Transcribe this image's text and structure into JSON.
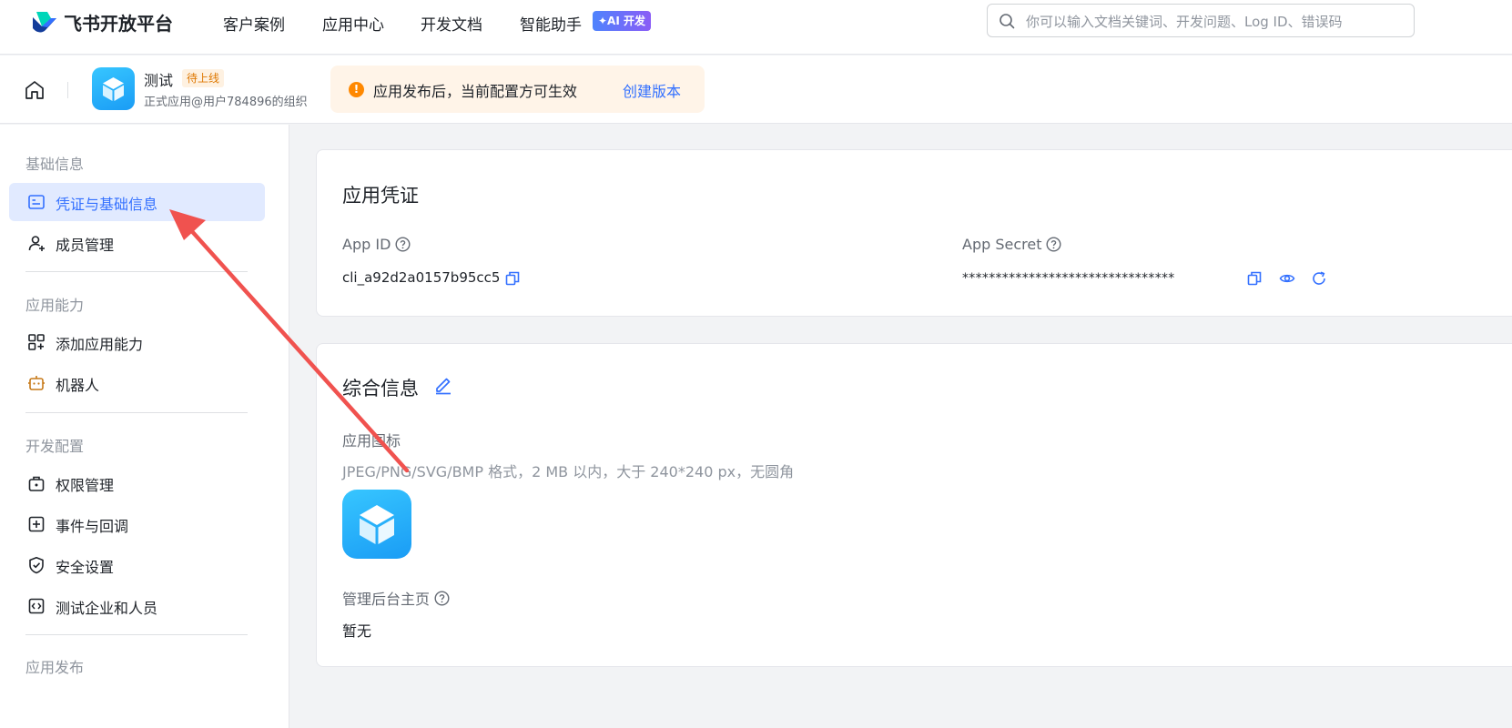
{
  "topnav": {
    "brand": "飞书开放平台",
    "links": [
      "客户案例",
      "应用中心",
      "开发文档",
      "智能助手"
    ],
    "ai_badge": "✦AI 开发",
    "search_placeholder": "你可以输入文档关键词、开发问题、Log ID、错误码"
  },
  "appbar": {
    "app_name": "测试",
    "status": "待上线",
    "org": "正式应用@用户784896的组织",
    "notice_text": "应用发布后，当前配置方可生效",
    "notice_action": "创建版本"
  },
  "sidebar": {
    "sections": [
      {
        "title": "基础信息",
        "items": [
          {
            "label": "凭证与基础信息",
            "icon": "credential-icon",
            "active": true
          },
          {
            "label": "成员管理",
            "icon": "member-icon",
            "active": false
          }
        ]
      },
      {
        "title": "应用能力",
        "items": [
          {
            "label": "添加应用能力",
            "icon": "add-capability-icon",
            "active": false
          },
          {
            "label": "机器人",
            "icon": "robot-icon",
            "active": false
          }
        ]
      },
      {
        "title": "开发配置",
        "items": [
          {
            "label": "权限管理",
            "icon": "permission-icon",
            "active": false
          },
          {
            "label": "事件与回调",
            "icon": "event-icon",
            "active": false
          },
          {
            "label": "安全设置",
            "icon": "shield-icon",
            "active": false
          },
          {
            "label": "测试企业和人员",
            "icon": "test-icon",
            "active": false
          }
        ]
      },
      {
        "title": "应用发布",
        "items": []
      }
    ]
  },
  "credentials": {
    "title": "应用凭证",
    "app_id_label": "App ID",
    "app_id_value": "cli_a92d2a0157b95cc5",
    "app_secret_label": "App Secret",
    "app_secret_value": "********************************"
  },
  "general_info": {
    "title": "综合信息",
    "icon_label": "应用图标",
    "icon_hint": "JPEG/PNG/SVG/BMP 格式，2 MB 以内，大于 240*240 px，无圆角",
    "admin_home_label": "管理后台主页",
    "admin_home_value": "暂无"
  },
  "colors": {
    "primary": "#3370ff",
    "active_bg": "#e1eaff",
    "notice_bg": "#fff4e8",
    "warning": "#ff8800",
    "annotation_arrow": "#f0524f"
  }
}
